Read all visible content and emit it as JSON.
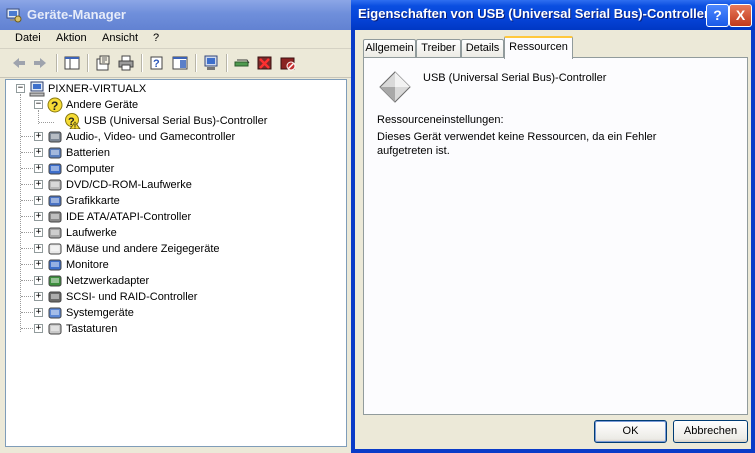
{
  "device_manager": {
    "title": "Geräte-Manager",
    "menu": [
      "Datei",
      "Aktion",
      "Ansicht",
      "?"
    ],
    "tree": {
      "root": "PIXNER-VIRTUALX",
      "expanded_group": "Andere Geräte",
      "expanded_child": "USB (Universal Serial Bus)-Controller",
      "groups": [
        "Audio-, Video- und Gamecontroller",
        "Batterien",
        "Computer",
        "DVD/CD-ROM-Laufwerke",
        "Grafikkarte",
        "IDE ATA/ATAPI-Controller",
        "Laufwerke",
        "Mäuse und andere Zeigegeräte",
        "Monitore",
        "Netzwerkadapter",
        "SCSI- und RAID-Controller",
        "Systemgeräte",
        "Tastaturen"
      ]
    }
  },
  "properties_dialog": {
    "title": "Eigenschaften von USB (Universal Serial Bus)-Controller",
    "help_button": "?",
    "close_button": "X",
    "tabs": [
      "Allgemein",
      "Treiber",
      "Details",
      "Ressourcen"
    ],
    "active_tab": "Ressourcen",
    "device_name": "USB (Universal Serial Bus)-Controller",
    "resource_settings_label": "Ressourceneinstellungen:",
    "message": "Dieses Gerät verwendet keine Ressourcen, da ein Fehler aufgetreten ist.",
    "ok_label": "OK",
    "cancel_label": "Abbrechen"
  }
}
